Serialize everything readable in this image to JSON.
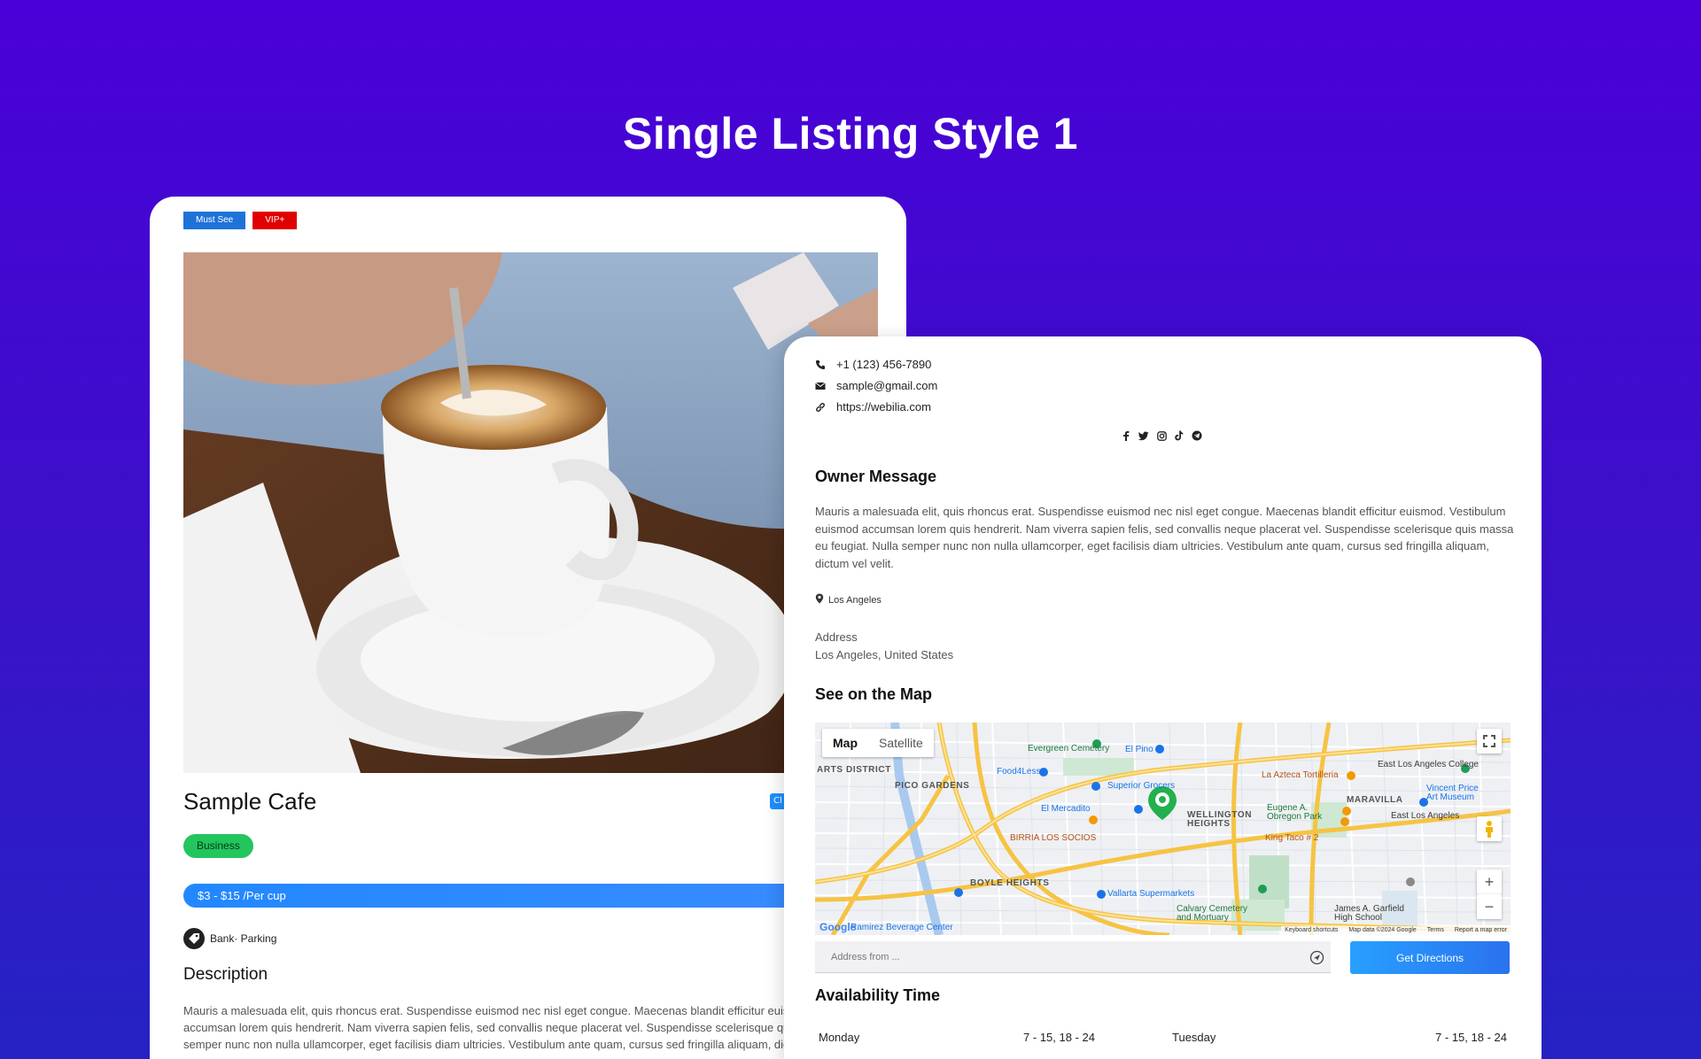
{
  "page": {
    "title": "Single Listing Style 1"
  },
  "left_card": {
    "badges": [
      {
        "label": "Must See",
        "color": "#1e73d8"
      },
      {
        "label": "VIP+",
        "color": "#e00000"
      }
    ],
    "listing_title": "Sample Cafe",
    "corner_tag": "Cl",
    "category": "Business",
    "price": "$3 - $15 /Per cup",
    "amenities": "Bank· Parking",
    "description_title": "Description",
    "description": "Mauris a malesuada elit, quis rhoncus erat. Suspendisse euismod nec nisl eget congue. Maecenas blandit efficitur euismod. Vestibulum euismod accumsan lorem quis hendrerit. Nam viverra sapien felis, sed convallis neque placerat vel. Suspendisse scelerisque quis massa eu feugiat. Nulla semper nunc non nulla ullamcorper, eget facilisis diam ultricies. Vestibulum ante quam, cursus sed fringilla aliquam, dictum vel velit."
  },
  "right_card": {
    "phone": "+1 (123) 456-7890",
    "email": "sample@gmail.com",
    "website": "https://webilia.com",
    "socials": [
      "facebook-icon",
      "twitter-icon",
      "instagram-icon",
      "tiktok-icon",
      "telegram-icon"
    ],
    "owner_title": "Owner Message",
    "owner_message": "Mauris a malesuada elit, quis rhoncus erat. Suspendisse euismod nec nisl eget congue. Maecenas blandit efficitur euismod. Vestibulum euismod accumsan lorem quis hendrerit. Nam viverra sapien felis, sed convallis neque placerat vel. Suspendisse scelerisque quis massa eu feugiat. Nulla semper nunc non nulla ullamcorper, eget facilisis diam ultricies. Vestibulum ante quam, cursus sed fringilla aliquam, dictum vel velit.",
    "location": "Los Angeles",
    "address_label": "Address",
    "address_value": "Los Angeles, United States",
    "map_title": "See on the Map",
    "map": {
      "tab_map": "Map",
      "tab_satellite": "Satellite",
      "labels": {
        "arts": "ARTS DISTRICT",
        "pico": "PICO GARDENS",
        "evergreen": "Evergreen Cemetery",
        "elpino": "El Pino",
        "food4less": "Food4Less",
        "superior": "Superior Grocers",
        "lazteca": "La Azteca Tortilleria",
        "eastla": "East Los Angeles College",
        "vincent": "Vincent Price Art Museum",
        "maravilla": "MARAVILLA",
        "elmercadito": "El Mercadito",
        "wellington": "WELLINGTON HEIGHTS",
        "eugene": "Eugene A. Obregon Park",
        "eastla2": "East Los Angeles",
        "birria": "BIRRIA LOS SOCIOS",
        "kingtaco": "King Taco # 2",
        "boyle": "BOYLE HEIGHTS",
        "vallarta": "Vallarta Supermarkets",
        "calvary": "Calvary Cemetery and Mortuary",
        "garfield": "James A. Garfield High School",
        "ramirez": "Ramirez Beverage Center"
      },
      "footer": [
        "Keyboard shortcuts",
        "Map data ©2024 Google",
        "Terms",
        "Report a map error"
      ],
      "logo": "Google"
    },
    "directions_placeholder": "Address from ...",
    "directions_button": "Get Directions",
    "availability_title": "Availability Time",
    "availability": [
      {
        "day": "Monday",
        "hours": "7 - 15, 18 - 24"
      },
      {
        "day": "Tuesday",
        "hours": "7 - 15, 18 - 24"
      }
    ]
  }
}
